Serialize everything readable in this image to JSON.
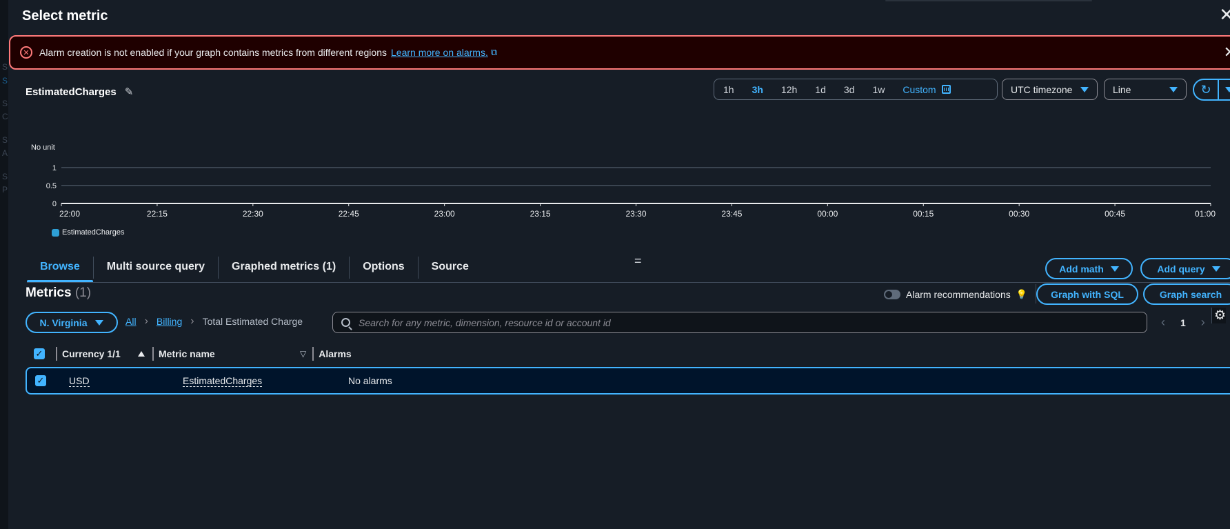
{
  "background_items": [
    "S",
    "S",
    "S",
    "C",
    "S",
    "A",
    "S",
    "P"
  ],
  "header": {
    "title": "Select metric",
    "close_icon": "close-icon"
  },
  "alert": {
    "message": "Alarm creation is not enabled if your graph contains metrics from different regions",
    "link": "Learn more on alarms.",
    "color": "#ff7a7a"
  },
  "graph": {
    "title": "EstimatedCharges",
    "time_ranges": [
      "1h",
      "3h",
      "12h",
      "1d",
      "3d",
      "1w"
    ],
    "active_range": "3h",
    "custom_label": "Custom",
    "timezone": "UTC timezone",
    "chart_type_label": "Line"
  },
  "chart_data": {
    "type": "line",
    "ylabel": "No unit",
    "y_ticks": [
      "1",
      "0.5",
      "0"
    ],
    "ylim": [
      0,
      1
    ],
    "x_ticks": [
      "22:00",
      "22:15",
      "22:30",
      "22:45",
      "23:00",
      "23:15",
      "23:30",
      "23:45",
      "00:00",
      "00:15",
      "00:30",
      "00:45",
      "01:00"
    ],
    "series": [
      {
        "name": "EstimatedCharges",
        "color": "#2ea0d6",
        "values": []
      }
    ],
    "grid": true,
    "legend": "bottom-left"
  },
  "tabs": [
    "Browse",
    "Multi source query",
    "Graphed metrics (1)",
    "Options",
    "Source"
  ],
  "active_tab": "Browse",
  "buttons": {
    "add_math": "Add math",
    "add_query": "Add query",
    "graph_sql": "Graph with SQL",
    "graph_search": "Graph search"
  },
  "metrics": {
    "heading": "Metrics",
    "count": "(1)",
    "alarm_recommendations": "Alarm recommendations"
  },
  "filter": {
    "region": "N. Virginia",
    "breadcrumbs": [
      "All",
      "Billing"
    ],
    "current": "Total Estimated Charge",
    "search_placeholder": "Search for any metric, dimension, resource id or account id",
    "page": "1"
  },
  "table": {
    "columns": [
      "Currency 1/1",
      "Metric name",
      "Alarms"
    ],
    "rows": [
      {
        "currency": "USD",
        "metric": "EstimatedCharges",
        "alarms": "No alarms"
      }
    ]
  },
  "colors": {
    "accent": "#42b4ff",
    "background": "#161d26",
    "error": "#ff7a7a"
  }
}
